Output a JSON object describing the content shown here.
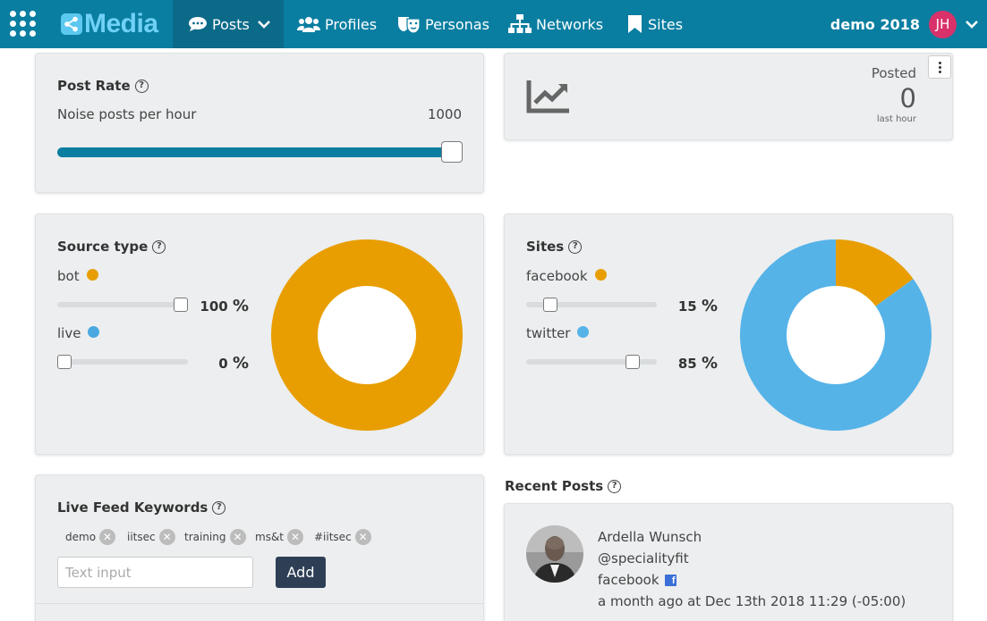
{
  "nav": {
    "brand": "Media",
    "items": [
      {
        "label": "Posts",
        "icon": "chat-icon"
      },
      {
        "label": "Profiles",
        "icon": "users-icon"
      },
      {
        "label": "Personas",
        "icon": "masks-icon"
      },
      {
        "label": "Networks",
        "icon": "sitemap-icon"
      },
      {
        "label": "Sites",
        "icon": "bookmark-icon"
      }
    ],
    "user": "demo 2018",
    "initials": "JH"
  },
  "post_rate": {
    "title": "Post Rate",
    "label": "Noise posts per hour",
    "value": "1000",
    "slider_fraction": 1.0
  },
  "posted": {
    "label": "Posted",
    "count": "0",
    "period": "last hour"
  },
  "source_type": {
    "title": "Source type",
    "items": [
      {
        "label": "bot",
        "color": "#e89e00",
        "percent": "100",
        "unit": "%",
        "fraction": 1.0
      },
      {
        "label": "live",
        "color": "#4aa8e0",
        "percent": "0",
        "unit": "%",
        "fraction": 0.0
      }
    ]
  },
  "sites": {
    "title": "Sites",
    "items": [
      {
        "label": "facebook",
        "color": "#e89e00",
        "percent": "15",
        "unit": "%",
        "fraction": 0.15
      },
      {
        "label": "twitter",
        "color": "#55b3e8",
        "percent": "85",
        "unit": "%",
        "fraction": 0.85
      }
    ]
  },
  "keywords": {
    "title": "Live Feed Keywords",
    "tags": [
      "demo",
      "iitsec",
      "training",
      "ms&t",
      "#iitsec"
    ],
    "placeholder": "Text input",
    "add_label": "Add"
  },
  "recent_posts": {
    "title": "Recent Posts",
    "post": {
      "name": "Ardella Wunsch",
      "handle": "@specialityfit",
      "site": "facebook",
      "time": "a month ago at Dec 13th 2018 11:29 (-05:00)"
    }
  }
}
